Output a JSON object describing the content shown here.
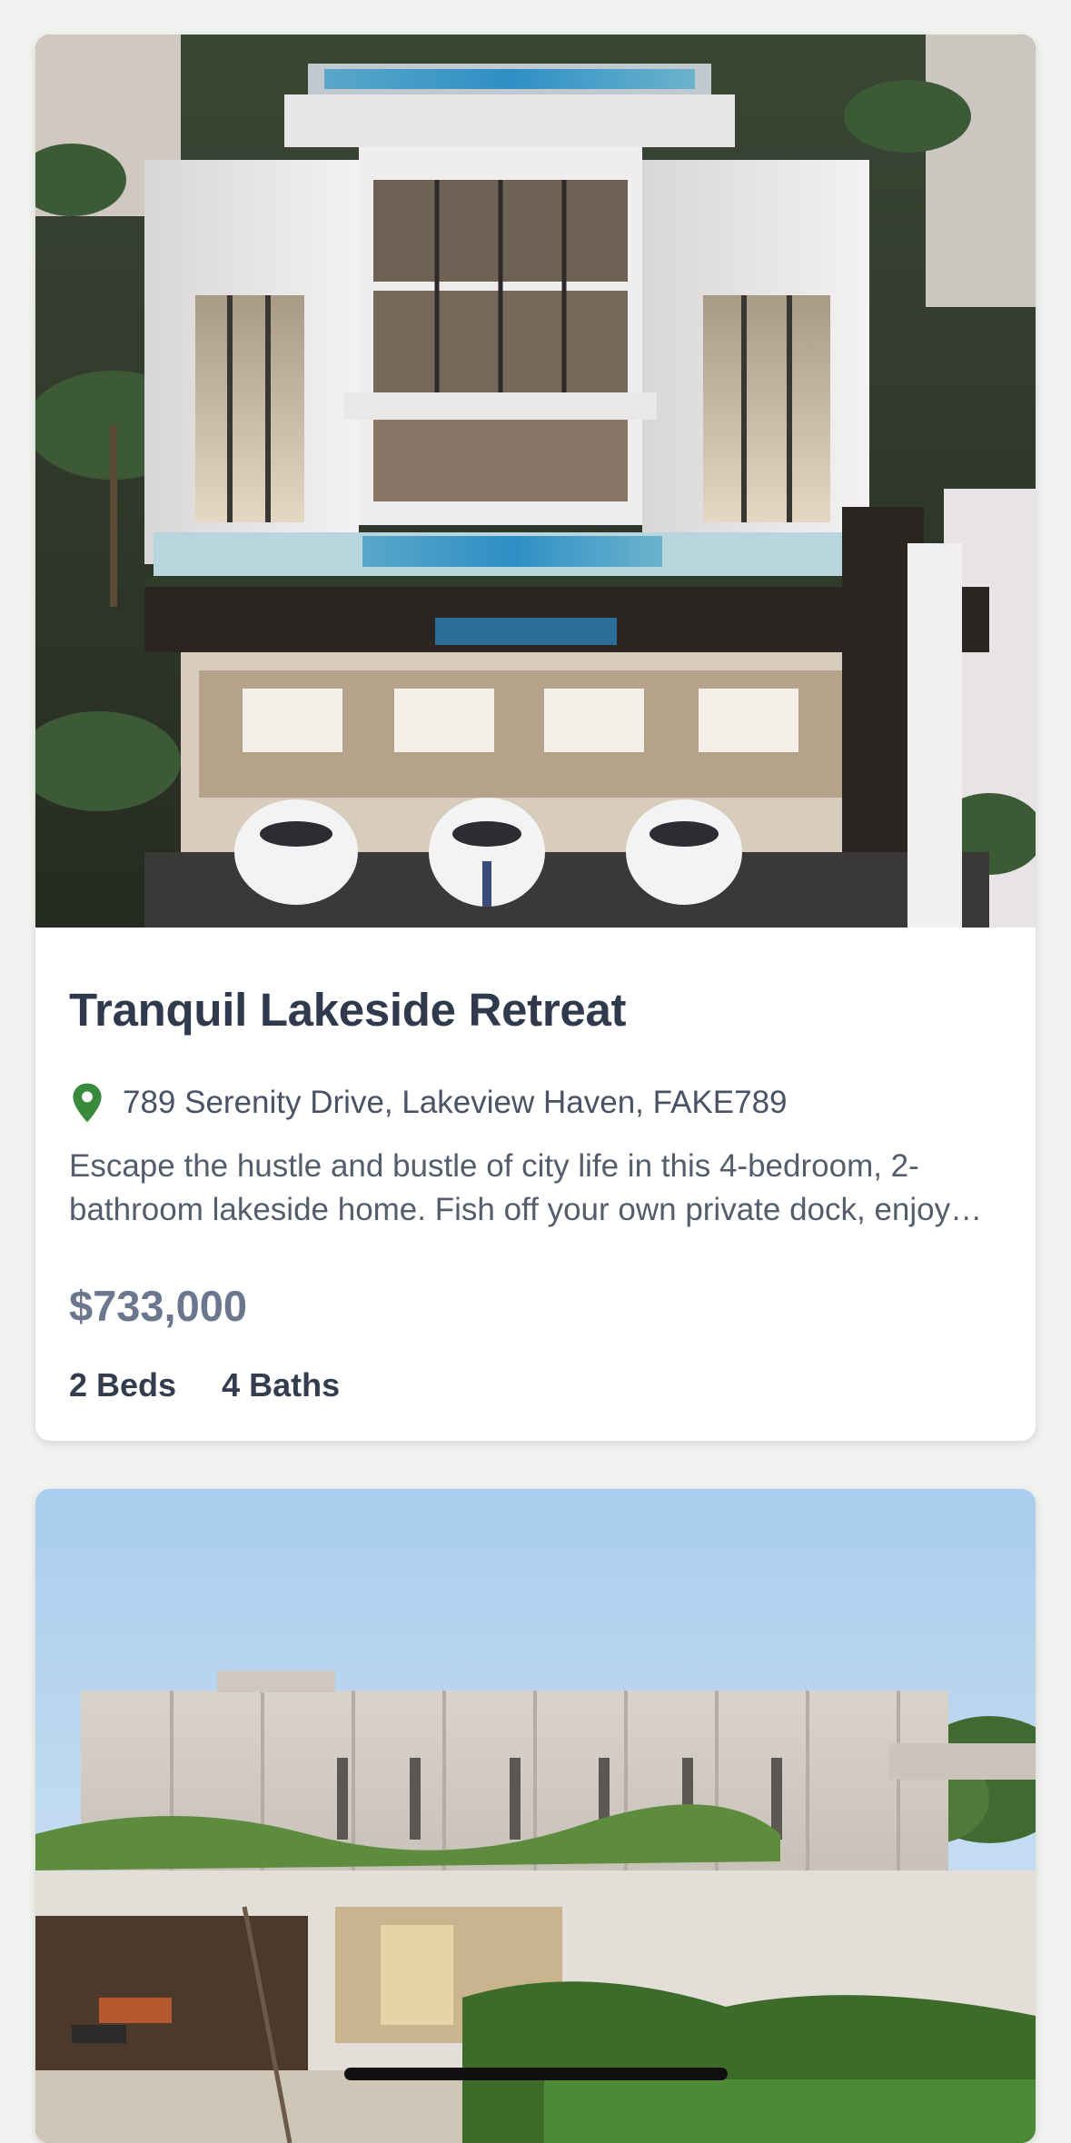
{
  "listings": [
    {
      "image_alt": "",
      "title": "Tranquil Lakeside Retreat",
      "address": "789 Serenity Drive, Lakeview Haven, FAKE789",
      "description": "Escape the hustle and bustle of city life in this 4-bedroom, 2-bathroom lakeside home. Fish off your own private dock, enjoy tranquil sunsets over the water and unwind in this peaceful retreat.",
      "price": "$733,000",
      "beds": "2 Beds",
      "baths": "4 Baths"
    },
    {
      "image_alt": ""
    }
  ],
  "colors": {
    "page_background": "#f1f3f1",
    "card_background": "#ffffff",
    "title": "#2f3a4d",
    "price": "#6b778d",
    "pin": "#3a8a3e"
  },
  "icons": {
    "location": "map-pin-icon"
  }
}
